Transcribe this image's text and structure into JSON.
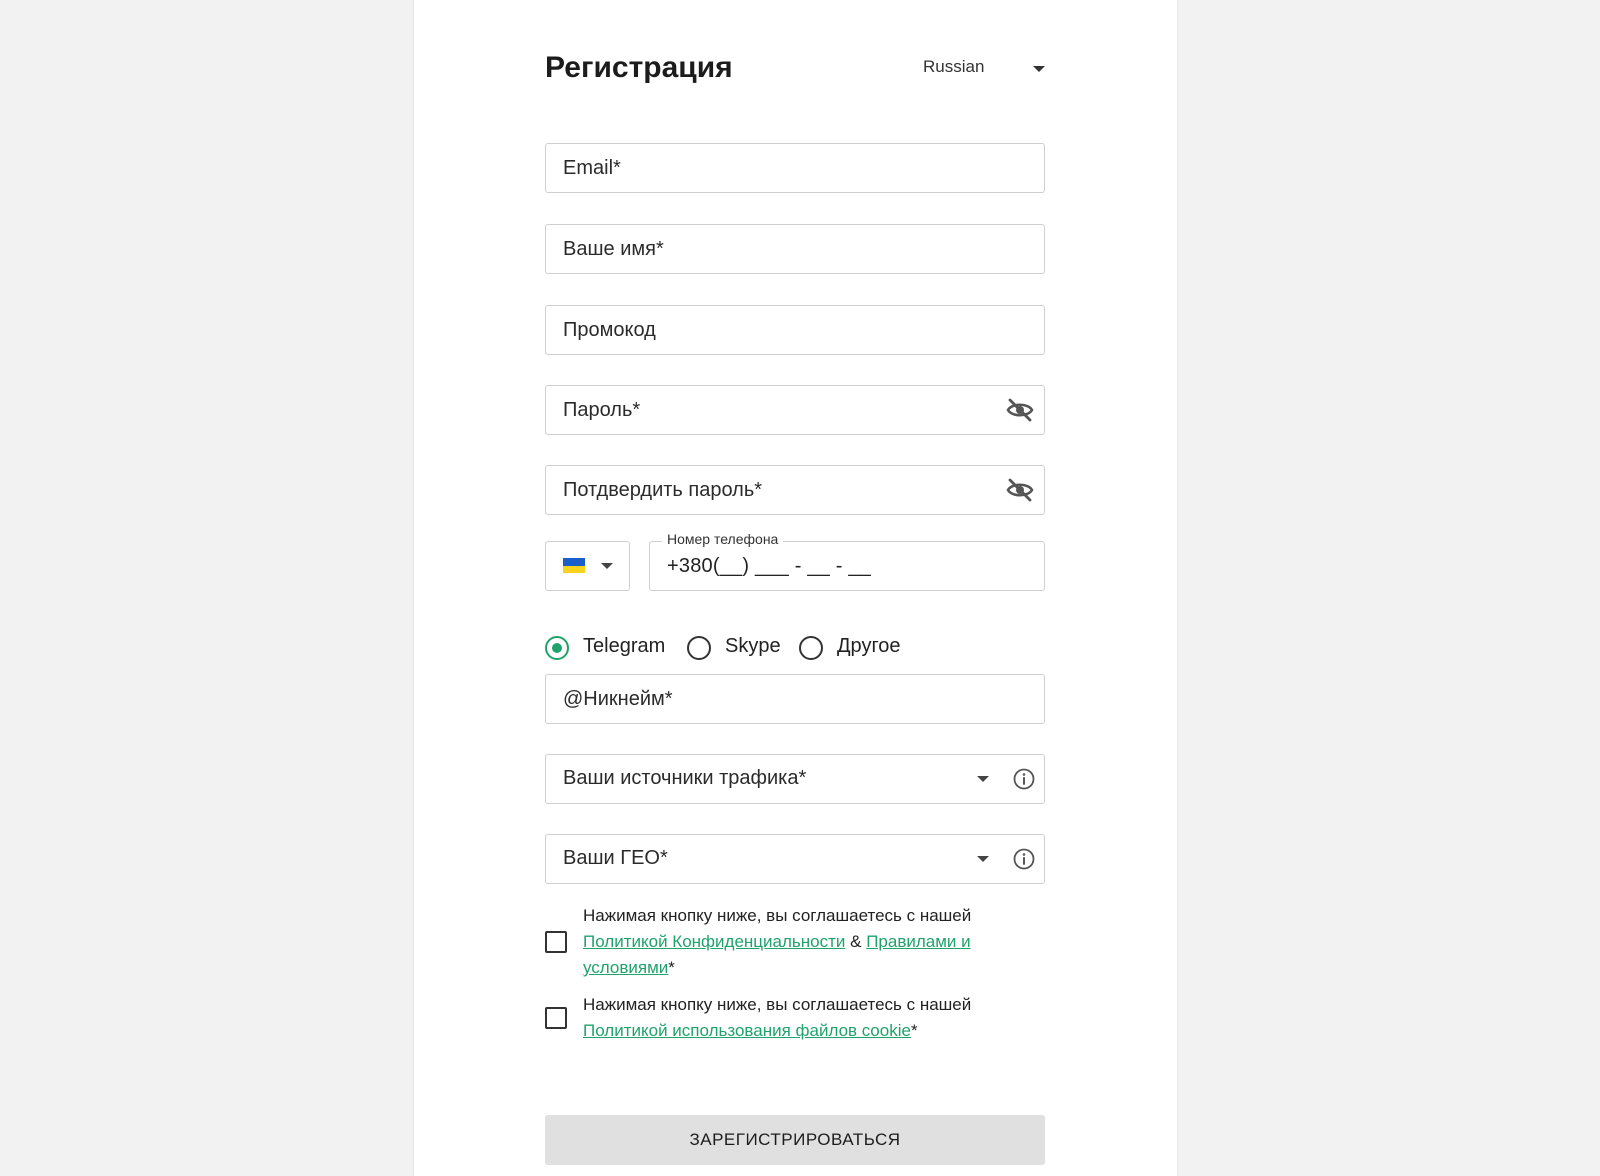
{
  "header": {
    "title": "Регистрация",
    "language": "Russian"
  },
  "fields": {
    "email": "Email*",
    "name": "Ваше имя*",
    "promo": "Промокод",
    "password": "Пароль*",
    "confirm_password": "Потдвердить пароль*",
    "nickname": "@Никнейм*",
    "traffic_sources": "Ваши источники трафика*",
    "geo": "Ваши ГЕО*"
  },
  "phone": {
    "country_flag": "ukraine-flag",
    "label": "Номер телефона",
    "value": "+380(__) ___ - __ - __"
  },
  "messenger": {
    "options": [
      {
        "label": "Telegram",
        "checked": true
      },
      {
        "label": "Skype",
        "checked": false
      },
      {
        "label": "Другое",
        "checked": false
      }
    ]
  },
  "consent": {
    "privacy": {
      "prefix": "Нажимая кнопку ниже, вы соглашаетесь с нашей",
      "privacy_link": "Политикой Конфиденциальности",
      "amp": "&",
      "terms_link": "Правилами и условиями",
      "required": "*",
      "checked": false
    },
    "cookie": {
      "prefix": "Нажимая кнопку ниже, вы соглашаетесь с нашей",
      "cookie_link": "Политикой использования файлов cookie",
      "required": "*",
      "checked": false
    }
  },
  "submit_label": "ЗАРЕГИСТРИРОВАТЬСЯ",
  "colors": {
    "accent": "#1fa36b",
    "button_bg": "#e0e0e0",
    "page_bg": "#f2f2f2",
    "border": "#cfcfcf"
  }
}
